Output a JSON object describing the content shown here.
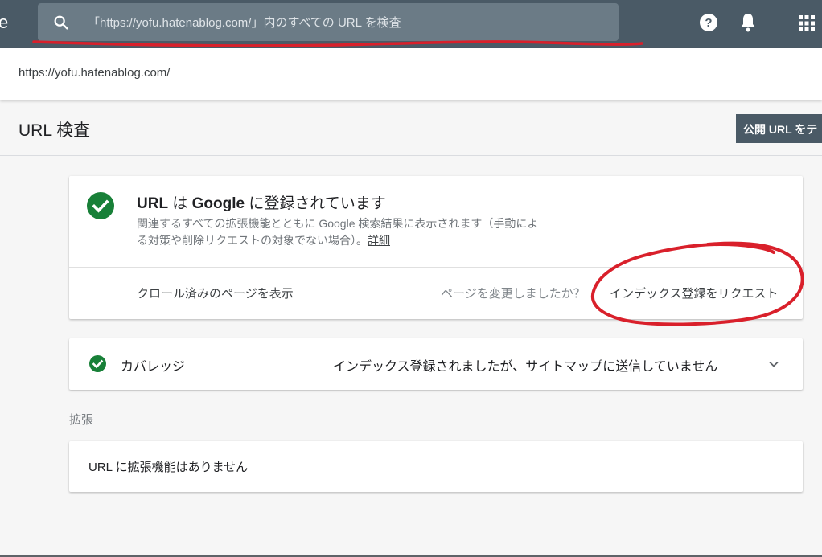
{
  "appbar": {
    "partial_letter": "e",
    "search_placeholder": "「https://yofu.hatenablog.com/」内のすべての URL を検査",
    "icons": [
      "search-icon",
      "help-icon",
      "bell-icon",
      "apps-icon"
    ]
  },
  "property": {
    "url": "https://yofu.hatenablog.com/"
  },
  "header": {
    "title": "URL 検査",
    "test_live_button": "公開 URL をテ"
  },
  "status_card": {
    "title_part1": "URL",
    "title_part2": " は ",
    "title_part3": "Google",
    "title_part4": " に登録されています",
    "desc_line1": "関連するすべての拡張機能とともに Google 検索結果に表示されます（手動によ",
    "desc_line2": "る対策や削除リクエストの対象でない場合）。",
    "detail_link": "詳細",
    "crawled_link": "クロール済みのページを表示",
    "changed_question": "ページを変更しましたか？",
    "request_indexing": "インデックス登録をリクエスト"
  },
  "coverage": {
    "label": "カバレッジ",
    "status": "インデックス登録されましたが、サイトマップに送信していません"
  },
  "enhancements": {
    "section_label": "拡張",
    "empty_text": "URL に拡張機能はありません"
  },
  "colors": {
    "appbar": "#4a5a66",
    "search_box": "#6b7b86",
    "success_green": "#188038",
    "annotation_red": "#d9202b"
  }
}
